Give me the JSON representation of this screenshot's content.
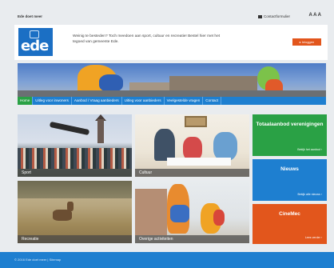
{
  "topbar": {
    "site_name": "Ede doet meer",
    "contact_label": "Contactformulier",
    "font_size_label": "A A A"
  },
  "header": {
    "logo_text": "ede",
    "intro_text": "Weinig te besteden? Toch meedoen aan sport, cultuur en recreatie! Bestel hier met het tegoed van gemeente Ede.",
    "cta_label": "▸ Inloggen"
  },
  "nav": {
    "items": [
      {
        "label": "Home",
        "active": true
      },
      {
        "label": "Uitleg voor inwoners",
        "active": false
      },
      {
        "label": "Aanbod / Vraag aanbieders",
        "active": false
      },
      {
        "label": "Uitleg voor aanbieders",
        "active": false
      },
      {
        "label": "Veelgestelde vragen",
        "active": false
      },
      {
        "label": "Contact",
        "active": false
      }
    ]
  },
  "tiles": {
    "sport": "Sport",
    "cultuur": "Cultuur",
    "recreatie": "Recreatie",
    "overig": "Overige activiteiten"
  },
  "side": {
    "green_title": "Totaalaanbod verenigingen",
    "green_more": "Bekijk het aanbod ›",
    "blue_title": "Nieuws",
    "blue_more": "Bekijk alle nieuws ›",
    "orange_title": "CineMec",
    "orange_more": "Lees verder ›"
  },
  "footer": {
    "copyright": "© 2016 Ede doet meer   |   Sitemap"
  },
  "colors": {
    "brand_blue": "#1e7fd0",
    "brand_green": "#2aa145",
    "brand_orange": "#e2561c"
  }
}
